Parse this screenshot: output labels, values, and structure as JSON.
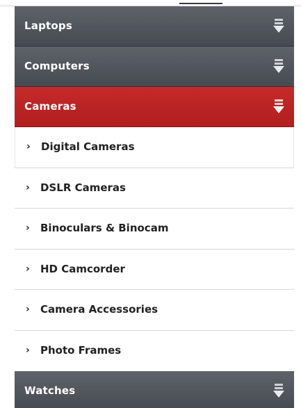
{
  "menu": {
    "categories": [
      {
        "label": "Laptops",
        "icon": "expand-arrow-icon",
        "active": false
      },
      {
        "label": "Computers",
        "icon": "expand-arrow-icon",
        "active": false
      },
      {
        "label": "Cameras",
        "icon": "expand-arrow-icon",
        "active": true
      },
      {
        "label": "Watches",
        "icon": "expand-arrow-icon",
        "active": false
      }
    ],
    "chevron": "›",
    "camera_subitems": [
      {
        "label": "Digital Cameras"
      },
      {
        "label": "DSLR Cameras"
      },
      {
        "label": "Binoculars & Binocam"
      },
      {
        "label": "HD Camcorder"
      },
      {
        "label": "Camera Accessories"
      },
      {
        "label": "Photo Frames"
      }
    ]
  },
  "colors": {
    "category_bg": "#4f535a",
    "active_bg": "#bb2323",
    "text_light": "#ffffff",
    "text_dark": "#222222",
    "divider": "#d6d6d6"
  }
}
